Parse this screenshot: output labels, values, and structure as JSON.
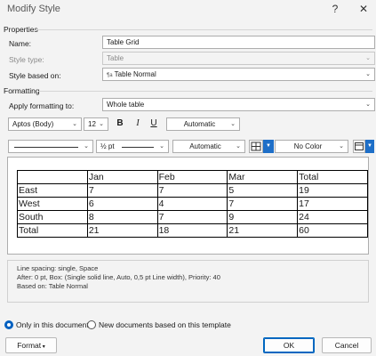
{
  "window": {
    "title": "Modify Style",
    "help_label": "?",
    "close_label": "✕"
  },
  "properties": {
    "section_label": "Properties",
    "name_label": "Name:",
    "name_value": "Table Grid",
    "style_type_label": "Style type:",
    "style_type_value": "Table",
    "based_on_label": "Style based on:",
    "based_on_value": "Table Normal",
    "based_on_icon": "table-style-icon"
  },
  "formatting": {
    "section_label": "Formatting",
    "apply_label": "Apply formatting to:",
    "apply_value": "Whole table",
    "font_value": "Aptos (Body)",
    "size_value": "12",
    "bold_label": "B",
    "italic_label": "I",
    "underline_label": "U",
    "font_color_value": "Automatic",
    "line_weight_value": "½ pt",
    "border_color_value": "Automatic",
    "shading_value": "No Color"
  },
  "preview_table": {
    "rows": [
      [
        "",
        "Jan",
        "Feb",
        "Mar",
        "Total"
      ],
      [
        "East",
        "7",
        "7",
        "5",
        "19"
      ],
      [
        "West",
        "6",
        "4",
        "7",
        "17"
      ],
      [
        "South",
        "8",
        "7",
        "9",
        "24"
      ],
      [
        "Total",
        "21",
        "18",
        "21",
        "60"
      ]
    ]
  },
  "description": {
    "line1": "Line spacing:  single, Space",
    "line2": "After:  0 pt, Box: (Single solid line, Auto,  0,5 pt Line width), Priority: 40",
    "line3": "Based on: Table Normal"
  },
  "options": {
    "only_this_doc_label": "Only in this document",
    "new_docs_label": "New documents based on this template",
    "only_this_doc_selected": true
  },
  "buttons": {
    "format_label": "Format",
    "ok_label": "OK",
    "cancel_label": "Cancel"
  },
  "colors": {
    "accent": "#0067c0",
    "background": "#f3f3f3"
  }
}
